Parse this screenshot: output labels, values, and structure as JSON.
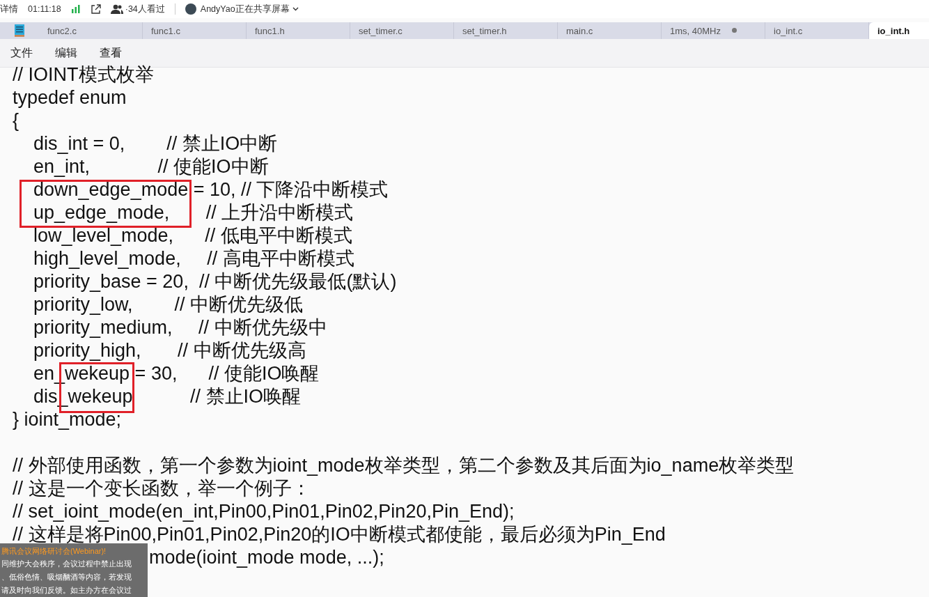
{
  "meeting_bar": {
    "details": "详情",
    "time": "01:11:18",
    "viewers": "·34人看过",
    "presenter": "AndyYao正在共享屏幕"
  },
  "tabs": [
    {
      "label": "func2.c",
      "selected": false,
      "modified": false
    },
    {
      "label": "func1.c",
      "selected": false,
      "modified": false
    },
    {
      "label": "func1.h",
      "selected": false,
      "modified": false
    },
    {
      "label": "set_timer.c",
      "selected": false,
      "modified": false
    },
    {
      "label": "set_timer.h",
      "selected": false,
      "modified": false
    },
    {
      "label": "main.c",
      "selected": false,
      "modified": false
    },
    {
      "label": "1ms, 40MHz",
      "selected": false,
      "modified": true
    },
    {
      "label": "io_int.c",
      "selected": false,
      "modified": false
    },
    {
      "label": "io_int.h",
      "selected": true,
      "modified": false
    }
  ],
  "menu": [
    "文件",
    "编辑",
    "查看"
  ],
  "code_lines": [
    "// IOINT模式枚举",
    "typedef enum",
    "{",
    "    dis_int = 0,        // 禁止IO中断",
    "    en_int,             // 使能IO中断",
    "    down_edge_mode = 10, // 下降沿中断模式",
    "    up_edge_mode,       // 上升沿中断模式",
    "    low_level_mode,      // 低电平中断模式",
    "    high_level_mode,     // 高电平中断模式",
    "    priority_base = 20,  // 中断优先级最低(默认)",
    "    priority_low,        // 中断优先级低",
    "    priority_medium,     // 中断优先级中",
    "    priority_high,       // 中断优先级高",
    "    en_wekeup = 30,      // 使能IO唤醒",
    "    dis_wekeup           // 禁止IO唤醒",
    "} ioint_mode;",
    "// 外部使用函数，第一个参数为ioint_mode枚举类型，第二个参数及其后面为io_name枚举类型",
    "// 这是一个变长函数，举一个例子：",
    "// set_ioint_mode(en_int,Pin00,Pin01,Pin02,Pin20,Pin_End);",
    "// 这样是将Pin00,Pin01,Pin02,Pin20的IO中断模式都使能，最后必须为Pin_End"
  ],
  "covered_line": "mode(ioint_mode mode, ...);",
  "notice": {
    "title": "腾讯会议网络研讨会(Webinar)!",
    "lines": [
      "同维护大会秩序，会议过程中禁止出现",
      "、低俗色情、吸烟酗酒等内容，若发现",
      "请及时向我们反馈。如主办方在会议过"
    ]
  }
}
